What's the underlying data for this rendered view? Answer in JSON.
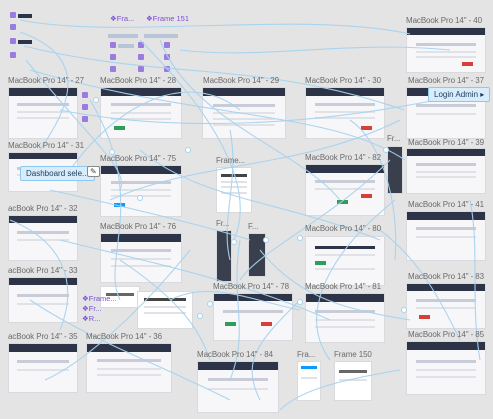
{
  "canvas": {
    "background": "#e4e4e4",
    "wire_color": "#a7d3ef",
    "accent_blue": "#0d99ff",
    "component_purple": "#7b4fd6"
  },
  "frames": {
    "mbp40": "MacBook Pro 14\" - 40",
    "mbp27": "MacBook Pro 14\" - 27",
    "mbp28": "MacBook Pro 14\" - 28",
    "mbp29": "MacBook Pro 14\" - 29",
    "mbp30": "MacBook Pro 14\" - 30",
    "mbp37": "MacBook Pro 14\" - 37",
    "mbp31": "MacBook Pro 14\" - 31",
    "mbp75": "MacBook Pro 14\" - 75",
    "frame_mid": "Frame...",
    "mbp82": "MacBook Pro 14\" - 82",
    "fr_small": "Fr...",
    "mbp39": "MacBook Pro 14\" - 39",
    "mbp32": "acBook Pro 14\" - 32",
    "mbp41": "MacBook Pro 14\" - 41",
    "mbp76": "MacBook Pro 14\" - 76",
    "fr_a": "Fr...",
    "fr_b": "F...",
    "mbp80": "MacBook Pro 14\" - 80",
    "mbp33": "acBook Pro 14\" - 33",
    "mbp78": "MacBook Pro 14\" - 78",
    "mbp81": "MacBook Pro 14\" - 81",
    "mbp83": "MacBook Pro 14\" - 83",
    "mbp35": "acBook Pro 14\" - 35",
    "mbp36": "MacBook Pro 14\" - 36",
    "mbp84": "MacBook Pro 14\" - 84",
    "fra": "Fra...",
    "mbp85": "MacBook Pro 14\" - 85",
    "frame150": "Frame 150"
  },
  "components": {
    "fra_top": "Fra...",
    "frame151": "Frame 151",
    "frame_a": "Frame...",
    "frame_b": "Fr...",
    "frame_c": "Fr...",
    "r": "R..."
  },
  "tags": {
    "login_admin": "Login Admin",
    "dashboard": "Dashboard sele..."
  },
  "icons": {
    "expand": "arrow-icon",
    "component": "component-icon",
    "comment": "comment-icon"
  }
}
